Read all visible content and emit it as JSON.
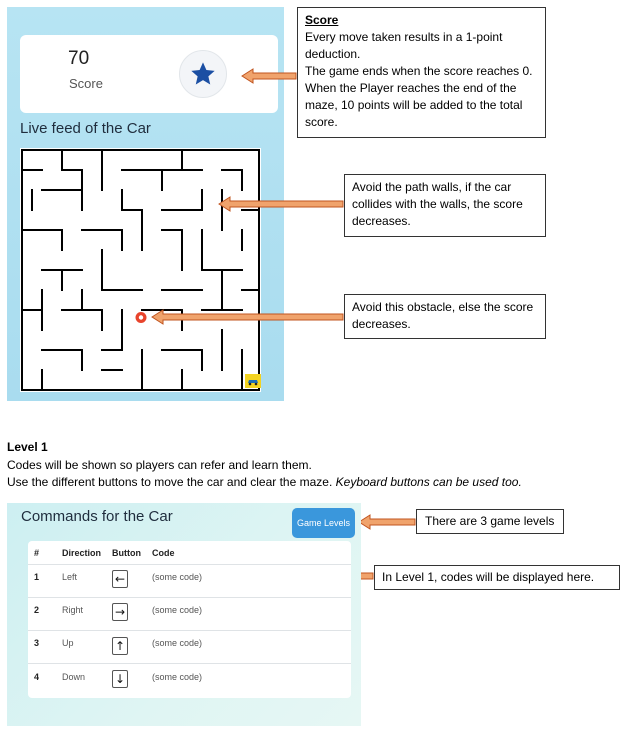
{
  "score_card": {
    "value": "70",
    "label": "Score"
  },
  "live_feed": {
    "title": "Live feed of the Car"
  },
  "callouts": {
    "score": {
      "title": "Score",
      "lines": [
        "Every move taken results in a 1-point",
        "deduction.",
        "The game ends when the score reaches 0.",
        "When the Player reaches the end of the",
        "maze, 10 points will be added to the total",
        "score."
      ]
    },
    "walls": {
      "lines": [
        "Avoid the path walls, if the car",
        "collides with the walls, the score",
        "decreases."
      ]
    },
    "obstacle": {
      "lines": [
        "Avoid this obstacle, else the score",
        "decreases."
      ]
    },
    "levels": {
      "text": "There are 3 game levels"
    },
    "codes": {
      "text": "In Level 1, codes will be displayed here."
    }
  },
  "level_info": {
    "title": "Level 1",
    "line1": "Codes will be shown so players can refer and learn them.",
    "line2_plain": "Use the different buttons to move the car and clear the maze. ",
    "line2_italic": "Keyboard buttons can be used too."
  },
  "commands": {
    "title": "Commands for the Car",
    "levels_button": "Game Levels",
    "headers": {
      "num": "#",
      "direction": "Direction",
      "button": "Button",
      "code": "Code"
    },
    "rows": [
      {
        "num": "1",
        "direction": "Left",
        "button_glyph": "←",
        "code": "(some code)"
      },
      {
        "num": "2",
        "direction": "Right",
        "button_glyph": "→",
        "code": "(some code)"
      },
      {
        "num": "3",
        "direction": "Up",
        "button_glyph": "↑",
        "code": "(some code)"
      },
      {
        "num": "4",
        "direction": "Down",
        "button_glyph": "↓",
        "code": "(some code)"
      }
    ]
  },
  "colors": {
    "panel_blue": "#b7e4f3",
    "star": "#1b4fa3",
    "button_blue": "#3a97dc",
    "arrow_fill": "#f0a36c",
    "arrow_stroke": "#c0541f",
    "obstacle": "#e8442c",
    "car_badge": "#f3d321"
  },
  "icons": [
    "star-icon",
    "obstacle-icon",
    "car-icon",
    "arrow-left-icon",
    "arrow-right-icon",
    "arrow-up-icon",
    "arrow-down-icon",
    "pointer-arrow-icon"
  ]
}
